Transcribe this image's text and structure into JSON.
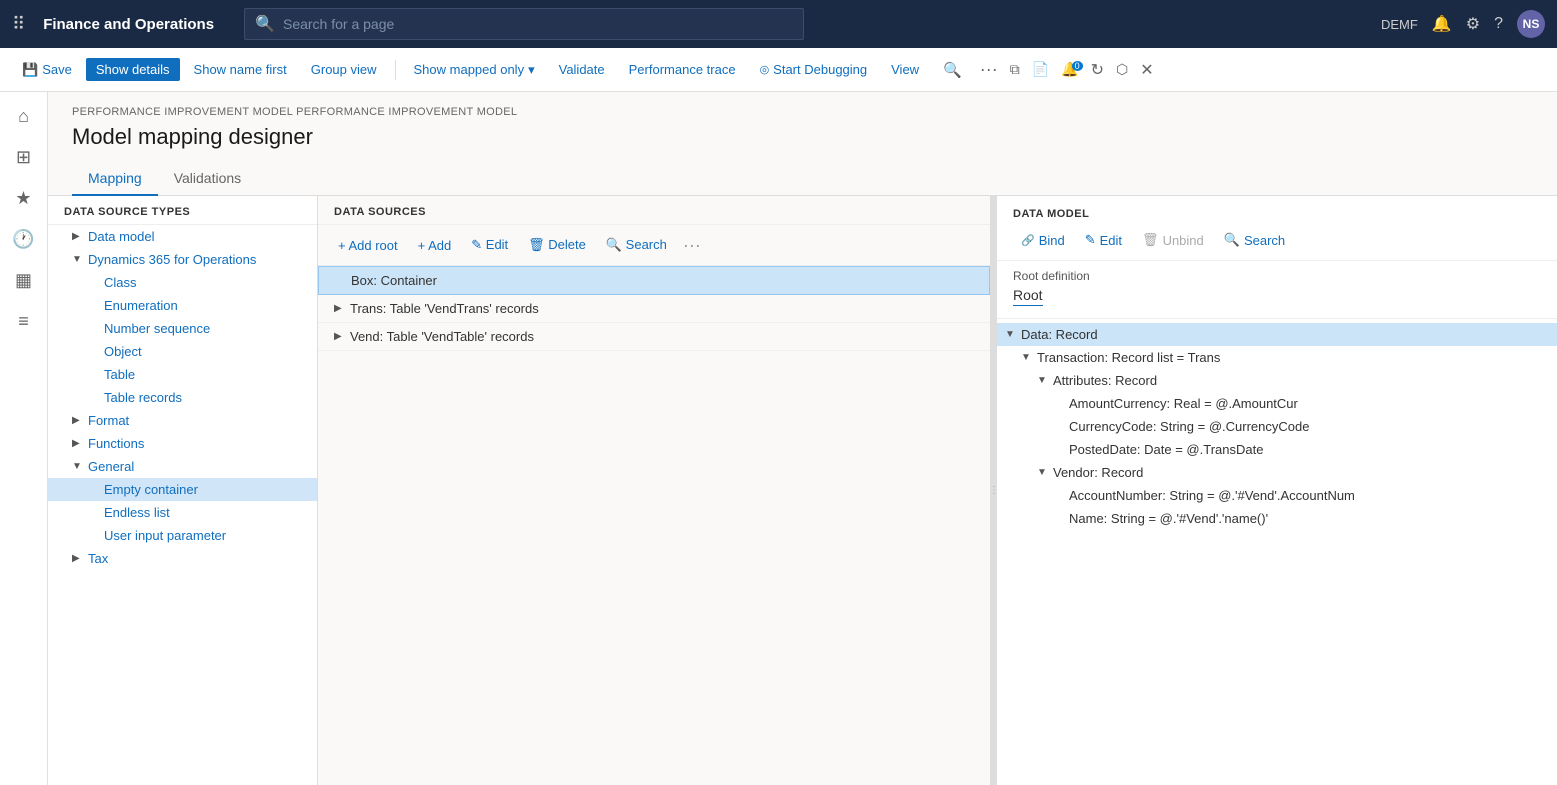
{
  "topNav": {
    "appTitle": "Finance and Operations",
    "searchPlaceholder": "Search for a page",
    "userLabel": "DEMF",
    "userInitials": "NS"
  },
  "cmdBar": {
    "saveLabel": "Save",
    "showDetailsLabel": "Show details",
    "showNameFirstLabel": "Show name first",
    "groupViewLabel": "Group view",
    "showMappedOnlyLabel": "Show mapped only",
    "validateLabel": "Validate",
    "performanceTraceLabel": "Performance trace",
    "startDebuggingLabel": "Start Debugging",
    "viewLabel": "View"
  },
  "breadcrumb": "PERFORMANCE IMPROVEMENT MODEL PERFORMANCE IMPROVEMENT MODEL",
  "pageTitle": "Model mapping designer",
  "tabs": [
    "Mapping",
    "Validations"
  ],
  "activeTab": "Mapping",
  "leftPanel": {
    "header": "DATA SOURCE TYPES",
    "items": [
      {
        "id": "data-model",
        "label": "Data model",
        "indent": 1,
        "hasArrow": true,
        "arrowRight": true
      },
      {
        "id": "dynamics-365",
        "label": "Dynamics 365 for Operations",
        "indent": 1,
        "hasArrow": true,
        "arrowDown": true
      },
      {
        "id": "class",
        "label": "Class",
        "indent": 2
      },
      {
        "id": "enumeration",
        "label": "Enumeration",
        "indent": 2
      },
      {
        "id": "number-sequence",
        "label": "Number sequence",
        "indent": 2
      },
      {
        "id": "object",
        "label": "Object",
        "indent": 2
      },
      {
        "id": "table",
        "label": "Table",
        "indent": 2
      },
      {
        "id": "table-records",
        "label": "Table records",
        "indent": 2
      },
      {
        "id": "format",
        "label": "Format",
        "indent": 1,
        "hasArrow": true,
        "arrowRight": true
      },
      {
        "id": "functions",
        "label": "Functions",
        "indent": 1,
        "hasArrow": true,
        "arrowRight": true
      },
      {
        "id": "general",
        "label": "General",
        "indent": 1,
        "hasArrow": true,
        "arrowDown": true
      },
      {
        "id": "empty-container",
        "label": "Empty container",
        "indent": 2,
        "selected": true
      },
      {
        "id": "endless-list",
        "label": "Endless list",
        "indent": 2
      },
      {
        "id": "user-input-parameter",
        "label": "User input parameter",
        "indent": 2
      },
      {
        "id": "tax",
        "label": "Tax",
        "indent": 1,
        "hasArrow": true,
        "arrowRight": true
      }
    ]
  },
  "midPanel": {
    "header": "DATA SOURCES",
    "toolbar": {
      "addRootLabel": "+ Add root",
      "addLabel": "+ Add",
      "editLabel": "✎ Edit",
      "deleteLabel": "🗑 Delete",
      "searchLabel": "🔍 Search"
    },
    "items": [
      {
        "id": "box",
        "label": "Box: Container",
        "indent": 0,
        "selected": true
      },
      {
        "id": "trans",
        "label": "Trans: Table 'VendTrans' records",
        "indent": 1,
        "hasArrow": true
      },
      {
        "id": "vend",
        "label": "Vend: Table 'VendTable' records",
        "indent": 1,
        "hasArrow": true
      }
    ]
  },
  "rightPanel": {
    "header": "DATA MODEL",
    "toolbar": {
      "bindLabel": "Bind",
      "editLabel": "Edit",
      "unbindLabel": "Unbind",
      "searchLabel": "Search"
    },
    "rootDefinitionLabel": "Root definition",
    "rootDefinitionValue": "Root",
    "items": [
      {
        "id": "data-record",
        "label": "Data: Record",
        "indent": 0,
        "hasArrow": true,
        "arrowDown": true,
        "selected": true
      },
      {
        "id": "transaction",
        "label": "Transaction: Record list = Trans",
        "indent": 1,
        "hasArrow": true,
        "arrowDown": true
      },
      {
        "id": "attributes",
        "label": "Attributes: Record",
        "indent": 2,
        "hasArrow": true,
        "arrowDown": true
      },
      {
        "id": "amount-currency",
        "label": "AmountCurrency: Real = @.AmountCur",
        "indent": 3
      },
      {
        "id": "currency-code",
        "label": "CurrencyCode: String = @.CurrencyCode",
        "indent": 3
      },
      {
        "id": "posted-date",
        "label": "PostedDate: Date = @.TransDate",
        "indent": 3
      },
      {
        "id": "vendor-record",
        "label": "Vendor: Record",
        "indent": 2,
        "hasArrow": true,
        "arrowDown": true
      },
      {
        "id": "account-number",
        "label": "AccountNumber: String = @.'#Vend'.AccountNum",
        "indent": 3
      },
      {
        "id": "name",
        "label": "Name: String = @.'#Vend'.'name()'",
        "indent": 3
      }
    ]
  }
}
